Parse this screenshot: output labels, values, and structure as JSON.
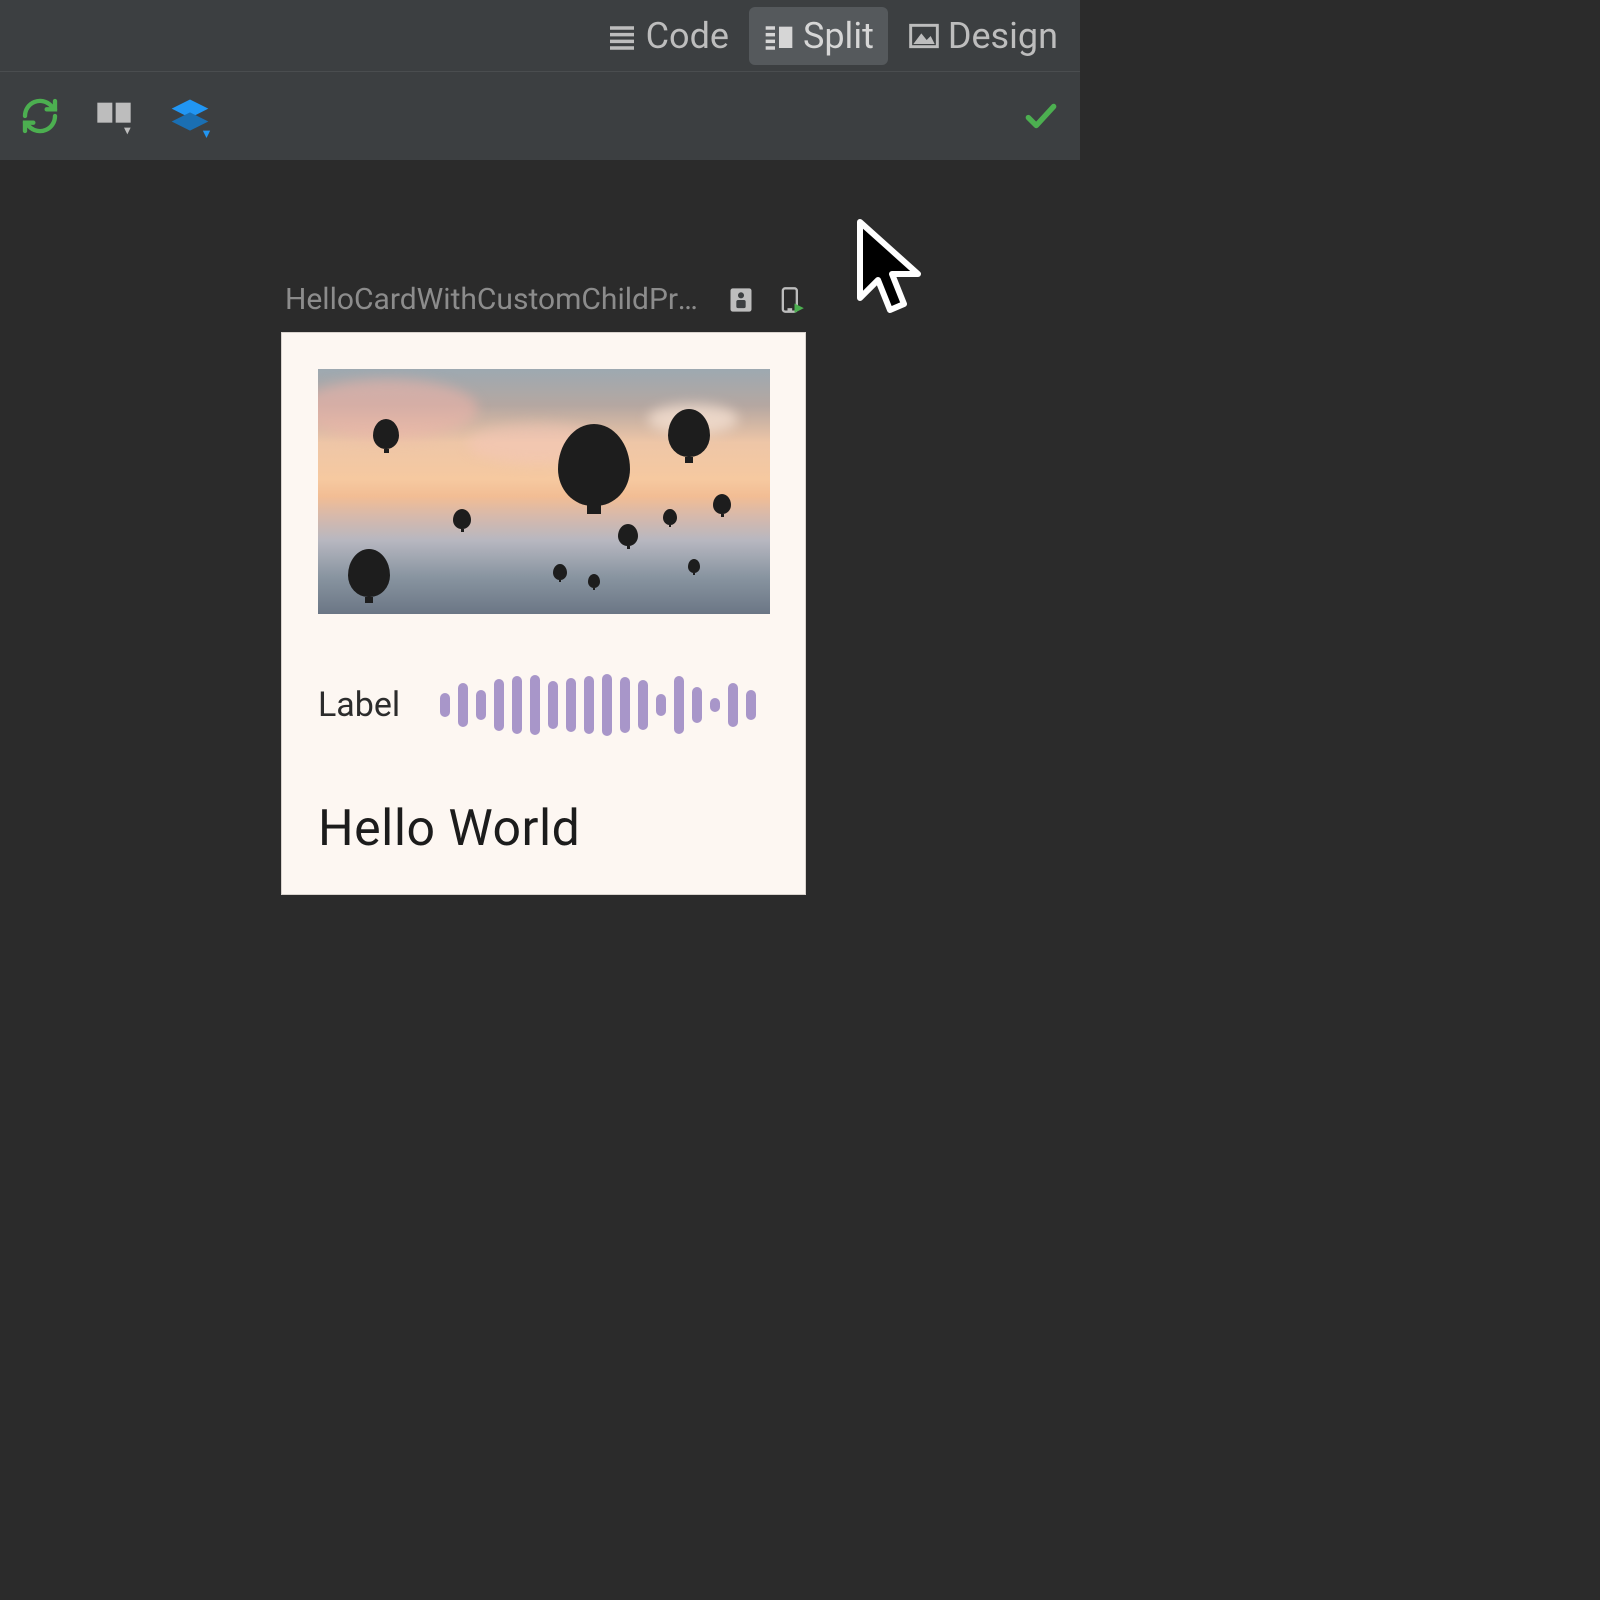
{
  "topbar": {
    "tabs": {
      "code": {
        "label": "Code",
        "active": false
      },
      "split": {
        "label": "Split",
        "active": true
      },
      "design": {
        "label": "Design",
        "active": false
      }
    }
  },
  "toolbar": {
    "icons": {
      "refresh": "refresh-icon",
      "panel": "panel-layout-icon",
      "layers": "layers-icon",
      "check": "check-icon"
    }
  },
  "preview": {
    "title": "HelloCardWithCustomChildPrev...",
    "actions": {
      "interactive": "interactive-preview-icon",
      "device": "device-run-icon"
    }
  },
  "card": {
    "label": "Label",
    "greeting": "Hello World",
    "waveform_heights": [
      24,
      44,
      30,
      52,
      58,
      60,
      48,
      54,
      58,
      62,
      56,
      50,
      22,
      58,
      36,
      14,
      44,
      30
    ],
    "colors": {
      "card_bg": "#fdf7f2",
      "bar": "#a896c9"
    }
  }
}
